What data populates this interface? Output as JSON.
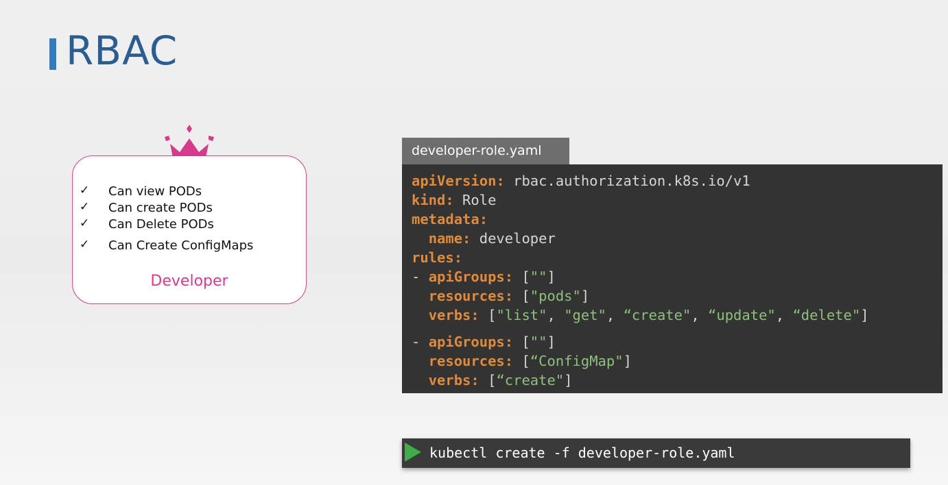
{
  "slide": {
    "title": "RBAC"
  },
  "developer_card": {
    "icon": "crown-icon",
    "permissions": [
      {
        "check": "✓",
        "label": "Can view PODs"
      },
      {
        "check": "✓",
        "label": "Can create PODs"
      },
      {
        "check": "✓",
        "label": "Can Delete PODs"
      },
      {
        "check": "✓",
        "label": "Can Create ConfigMaps"
      }
    ],
    "role_name": "Developer"
  },
  "yaml": {
    "filename": "developer-role.yaml",
    "lines": {
      "l1_key": "apiVersion:",
      "l1_val": " rbac.authorization.k8s.io/v1",
      "l2_key": "kind:",
      "l2_val": " Role",
      "l3_key": "metadata:",
      "l4_key": "name:",
      "l4_val": " developer",
      "l5_key": "rules:",
      "l6_dash": "- ",
      "l6_key": "apiGroups:",
      "l6_open": " [",
      "l6_str": "\"\"",
      "l6_close": "]",
      "l7_key": "resources:",
      "l7_open": " [",
      "l7_str": "\"pods\"",
      "l7_close": "]",
      "l8_key": "verbs:",
      "l8_open": " [",
      "l8_s1": "\"list\"",
      "l8_c1": ", ",
      "l8_s2": "\"get\"",
      "l8_c2": ", ",
      "l8_s3": "“create\"",
      "l8_c3": ", ",
      "l8_s4": "“update\"",
      "l8_c4": ", ",
      "l8_s5": "“delete\"",
      "l8_close": "]",
      "l9_dash": "- ",
      "l9_key": "apiGroups:",
      "l9_open": " [",
      "l9_str": "\"\"",
      "l9_close": "]",
      "l10_key": "resources:",
      "l10_open": " [",
      "l10_str": "“ConfigMap\"",
      "l10_close": "]",
      "l11_key": "verbs:",
      "l11_open": " [",
      "l11_str": "“create\"",
      "l11_close": "]"
    }
  },
  "terminal": {
    "icon": "play-icon",
    "command": "kubectl create -f developer-role.yaml"
  },
  "colors": {
    "title": "#2b5d92",
    "accent_bar": "#2f7dbf",
    "pink": "#d63a8b",
    "code_bg": "#333333",
    "yaml_key": "#e08a3b",
    "yaml_string": "#8ec07c",
    "play_green": "#3fae49"
  }
}
